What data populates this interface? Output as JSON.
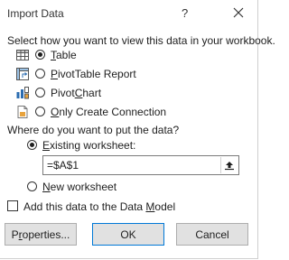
{
  "window": {
    "title": "Import Data",
    "help": "?"
  },
  "view_section": {
    "label": "Select how you want to view this data in your workbook.",
    "options": [
      {
        "label_pre": "",
        "mnemonic": "T",
        "label_post": "able",
        "checked": true,
        "icon": "table-icon"
      },
      {
        "label_pre": "",
        "mnemonic": "P",
        "label_post": "ivotTable Report",
        "checked": false,
        "icon": "pivottable-icon"
      },
      {
        "label_pre": "Pivot",
        "mnemonic": "C",
        "label_post": "hart",
        "checked": false,
        "icon": "pivotchart-icon"
      },
      {
        "label_pre": "",
        "mnemonic": "O",
        "label_post": "nly Create Connection",
        "checked": false,
        "icon": "connection-icon"
      }
    ]
  },
  "destination_section": {
    "label": "Where do you want to put the data?",
    "existing": {
      "label_pre": "",
      "mnemonic": "E",
      "label_post": "xisting worksheet:",
      "checked": true
    },
    "reference": "=$A$1",
    "new": {
      "label_pre": "",
      "mnemonic": "N",
      "label_post": "ew worksheet",
      "checked": false
    }
  },
  "data_model": {
    "label_pre": "Add this data to the Data ",
    "mnemonic": "M",
    "label_post": "odel",
    "checked": false
  },
  "buttons": {
    "properties": {
      "label_pre": "P",
      "mnemonic": "r",
      "label_post": "operties..."
    },
    "ok": "OK",
    "cancel": "Cancel"
  },
  "colors": {
    "accent": "#0078d7",
    "button_bg": "#e1e1e1"
  }
}
